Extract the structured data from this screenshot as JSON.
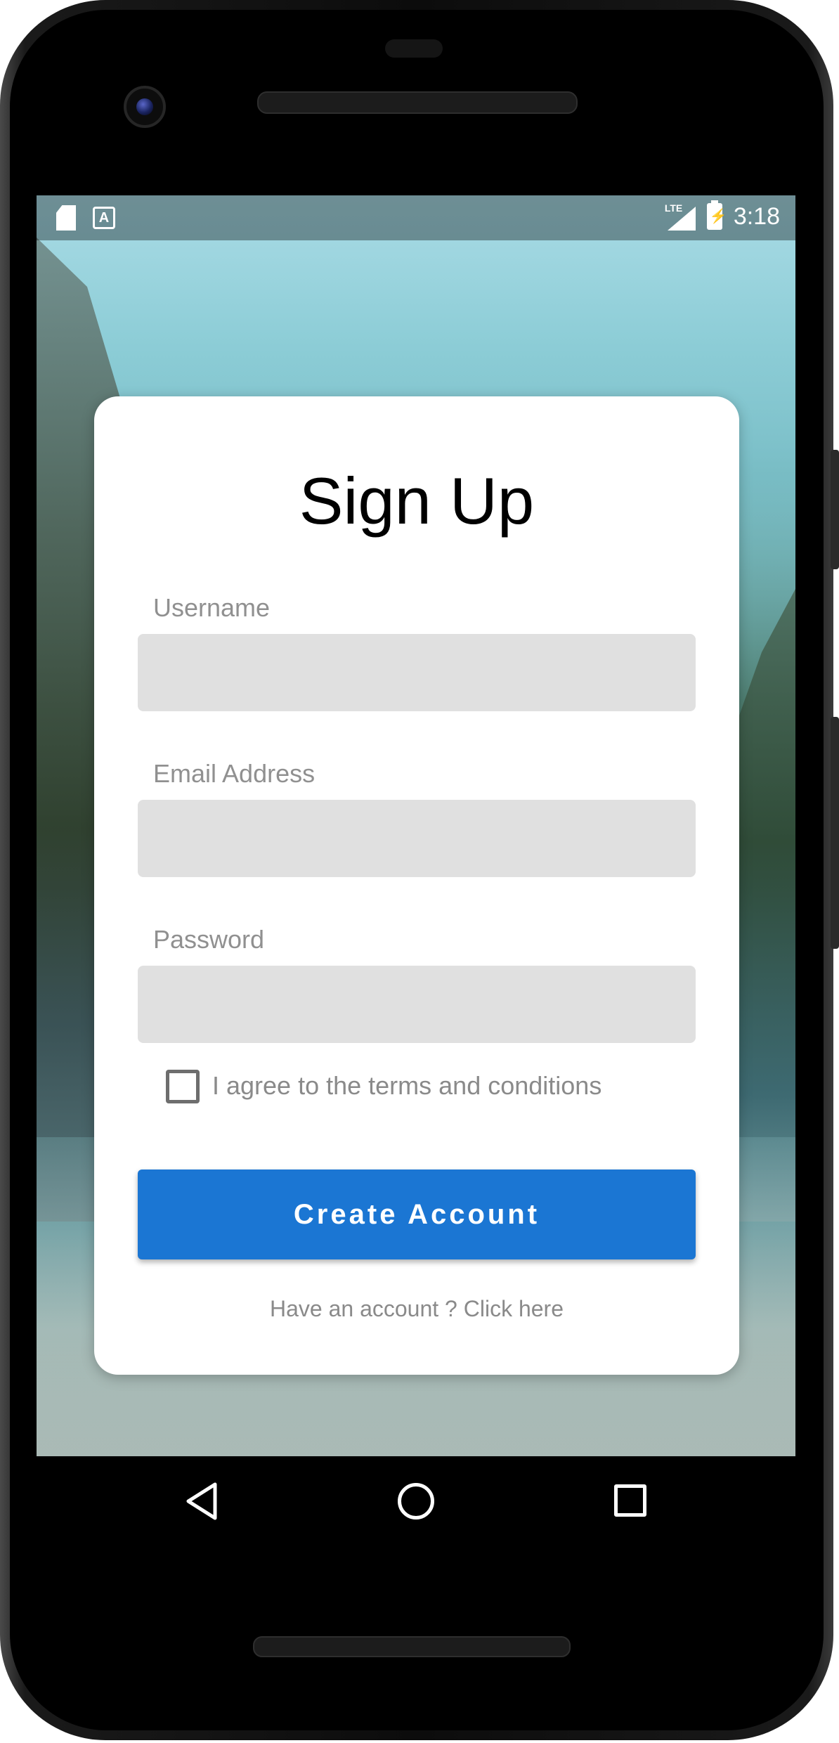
{
  "status_bar": {
    "time": "3:18",
    "network": "LTE",
    "icons": [
      "sd-card-icon",
      "a-notification-icon",
      "signal-icon",
      "battery-charging-icon"
    ]
  },
  "form": {
    "title": "Sign Up",
    "fields": [
      {
        "label": "Username",
        "value": "",
        "placeholder": ""
      },
      {
        "label": "Email Address",
        "value": "",
        "placeholder": ""
      },
      {
        "label": "Password",
        "value": "",
        "placeholder": ""
      }
    ],
    "terms_label": "I agree to the terms and conditions",
    "terms_checked": false,
    "submit_label": "Create Account",
    "login_link": "Have an account ? Click here"
  },
  "nav_bar": {
    "icons": [
      "back-icon",
      "home-icon",
      "recents-icon"
    ]
  },
  "colors": {
    "primary": "#1b76d3",
    "input_bg": "#e0e0e0",
    "label": "#909090"
  }
}
